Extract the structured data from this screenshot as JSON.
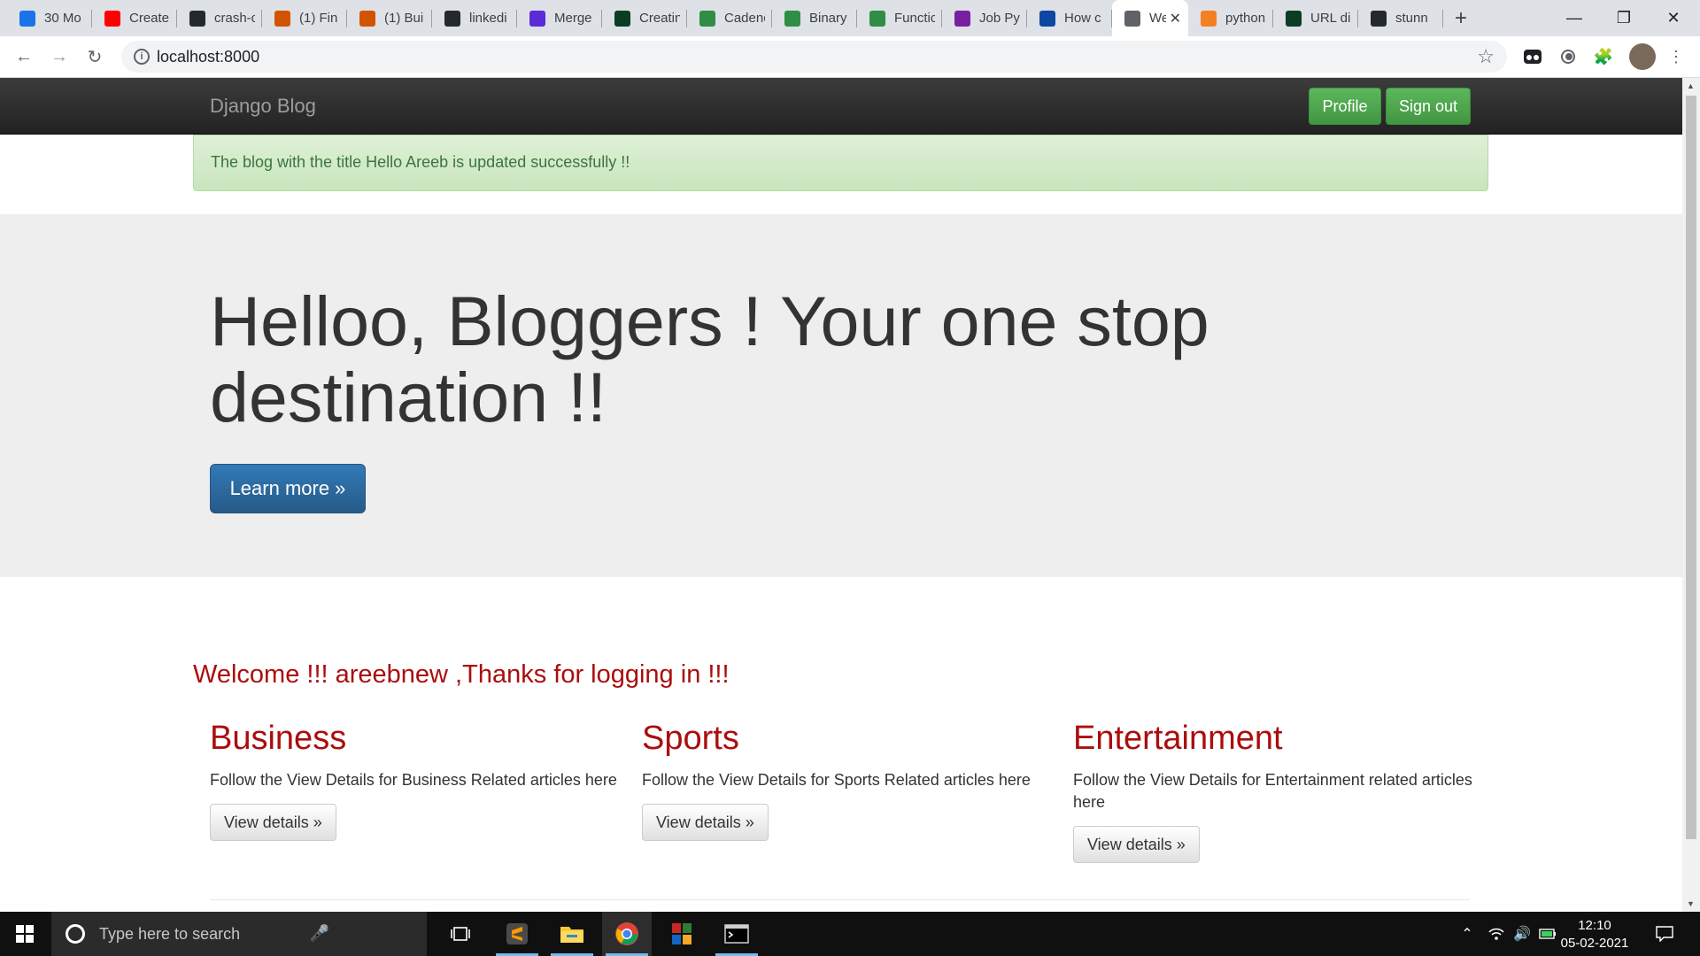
{
  "browser": {
    "tabs": [
      {
        "title": "30 Mo",
        "icon": "circle-d-icon",
        "color": "#1a73e8"
      },
      {
        "title": "Create",
        "icon": "youtube-icon",
        "color": "#ff0000"
      },
      {
        "title": "crash-c",
        "icon": "github-icon",
        "color": "#24292e"
      },
      {
        "title": "(1) Fin",
        "icon": "c-logo-icon",
        "color": "#d35400"
      },
      {
        "title": "(1) Bui",
        "icon": "c-logo-icon",
        "color": "#d35400"
      },
      {
        "title": "linkedi",
        "icon": "github-icon",
        "color": "#24292e"
      },
      {
        "title": "Merge",
        "icon": "m-logo-icon",
        "color": "#5b2bd8"
      },
      {
        "title": "Creatin",
        "icon": "dj-icon",
        "color": "#0c3c26"
      },
      {
        "title": "Cadenc",
        "icon": "gfg-icon",
        "color": "#2f8d46"
      },
      {
        "title": "Binary",
        "icon": "gfg-icon",
        "color": "#2f8d46"
      },
      {
        "title": "Functic",
        "icon": "gfg-icon",
        "color": "#2f8d46"
      },
      {
        "title": "Job Pyt",
        "icon": "t-logo-icon",
        "color": "#7b1fa2"
      },
      {
        "title": "How c",
        "icon": "e-logo-icon",
        "color": "#0d47a1"
      },
      {
        "title": "We",
        "icon": "globe-icon",
        "color": "#5f6368",
        "active": true
      },
      {
        "title": "python",
        "icon": "stackoverflow-icon",
        "color": "#f48024"
      },
      {
        "title": "URL di",
        "icon": "dj-icon",
        "color": "#0c3c26"
      },
      {
        "title": "stunn",
        "icon": "github-icon",
        "color": "#24292e"
      }
    ],
    "url": "localhost:8000"
  },
  "navbar": {
    "brand": "Django Blog",
    "profile_label": "Profile",
    "signout_label": "Sign out"
  },
  "alert": {
    "message": "The blog with the title Hello Areeb is updated successfully !!"
  },
  "jumbotron": {
    "heading": "Helloo, Bloggers ! Your one stop destination !!",
    "button_label": "Learn more »"
  },
  "welcome": "Welcome !!! areebnew ,Thanks for logging in !!!",
  "sections": [
    {
      "title": "Business",
      "text": "Follow the View Details for Business Related articles here",
      "button": "View details »"
    },
    {
      "title": "Sports",
      "text": "Follow the View Details for Sports Related articles here",
      "button": "View details »"
    },
    {
      "title": "Entertainment",
      "text": "Follow the View Details for Entertainment related articles here",
      "button": "View details »"
    }
  ],
  "taskbar": {
    "search_placeholder": "Type here to search",
    "time": "12:10",
    "date": "05-02-2021"
  },
  "colors": {
    "navbar": "#222222",
    "alert_bg": "#dff0d8",
    "alert_text": "#3c763d",
    "accent_red": "#ab0d0d",
    "green_button": "#5cb85c",
    "primary_button": "#337ab7"
  }
}
